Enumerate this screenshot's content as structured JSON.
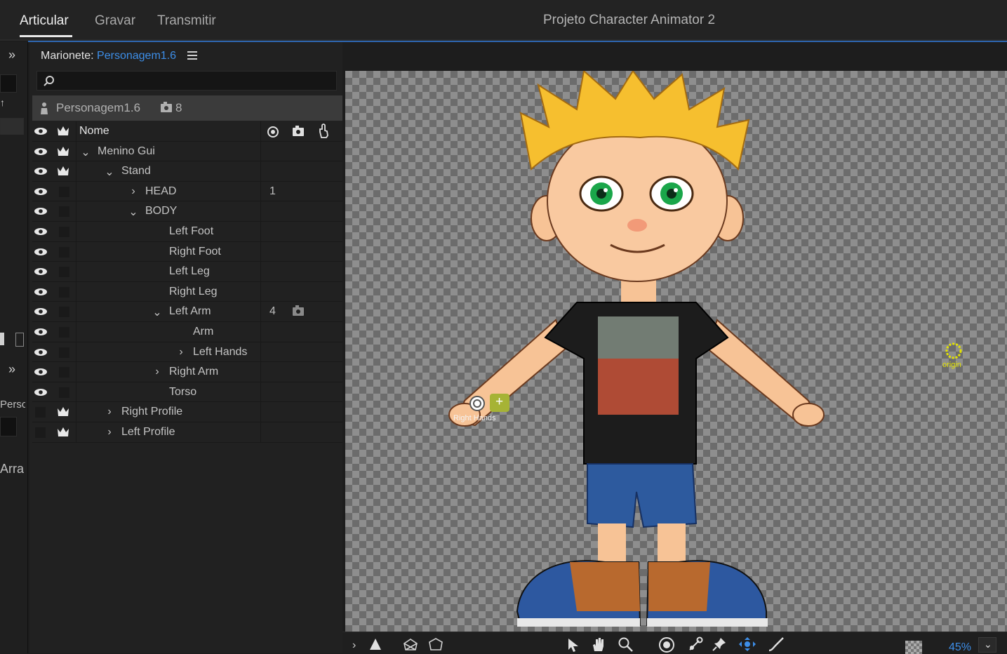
{
  "tabs": [
    {
      "label": "Articular"
    },
    {
      "label": "Gravar"
    },
    {
      "label": "Transmitir"
    }
  ],
  "project_title": "Projeto Character Animator 2",
  "left_strip": {
    "text1": "Persc",
    "text2": "Arra"
  },
  "panel": {
    "title_prefix": "Marionete:",
    "title_name": "Personagem1.6",
    "search_placeholder": "",
    "puppet_name": "Personagem1.6",
    "puppet_count": "8",
    "header_label": "Nome"
  },
  "layers": [
    {
      "label": "Menino Gui",
      "num": "",
      "chev": "⌄"
    },
    {
      "label": "Stand",
      "num": "",
      "chev": "⌄"
    },
    {
      "label": "HEAD",
      "num": "1",
      "chev": "›"
    },
    {
      "label": "BODY",
      "num": "",
      "chev": "⌄"
    },
    {
      "label": "Left Foot",
      "num": "",
      "chev": ""
    },
    {
      "label": "Right Foot",
      "num": "",
      "chev": ""
    },
    {
      "label": "Left Leg",
      "num": "",
      "chev": ""
    },
    {
      "label": "Right Leg",
      "num": "",
      "chev": ""
    },
    {
      "label": "Left Arm",
      "num": "4",
      "chev": "⌄"
    },
    {
      "label": "Arm",
      "num": "",
      "chev": ""
    },
    {
      "label": "Left Hands",
      "num": "",
      "chev": "›"
    },
    {
      "label": "Right Arm",
      "num": "",
      "chev": "›"
    },
    {
      "label": "Torso",
      "num": "",
      "chev": ""
    },
    {
      "label": "Right Profile",
      "num": "",
      "chev": "›"
    },
    {
      "label": "Left Profile",
      "num": "",
      "chev": "›"
    }
  ],
  "canvas": {
    "origin_label": "origin",
    "hands_label": "Right Hands"
  },
  "bottom": {
    "zoom": "45%"
  },
  "colors": {
    "accent": "#3d8ee8",
    "origin": "#e3e300",
    "handle_add": "#a6b335"
  }
}
